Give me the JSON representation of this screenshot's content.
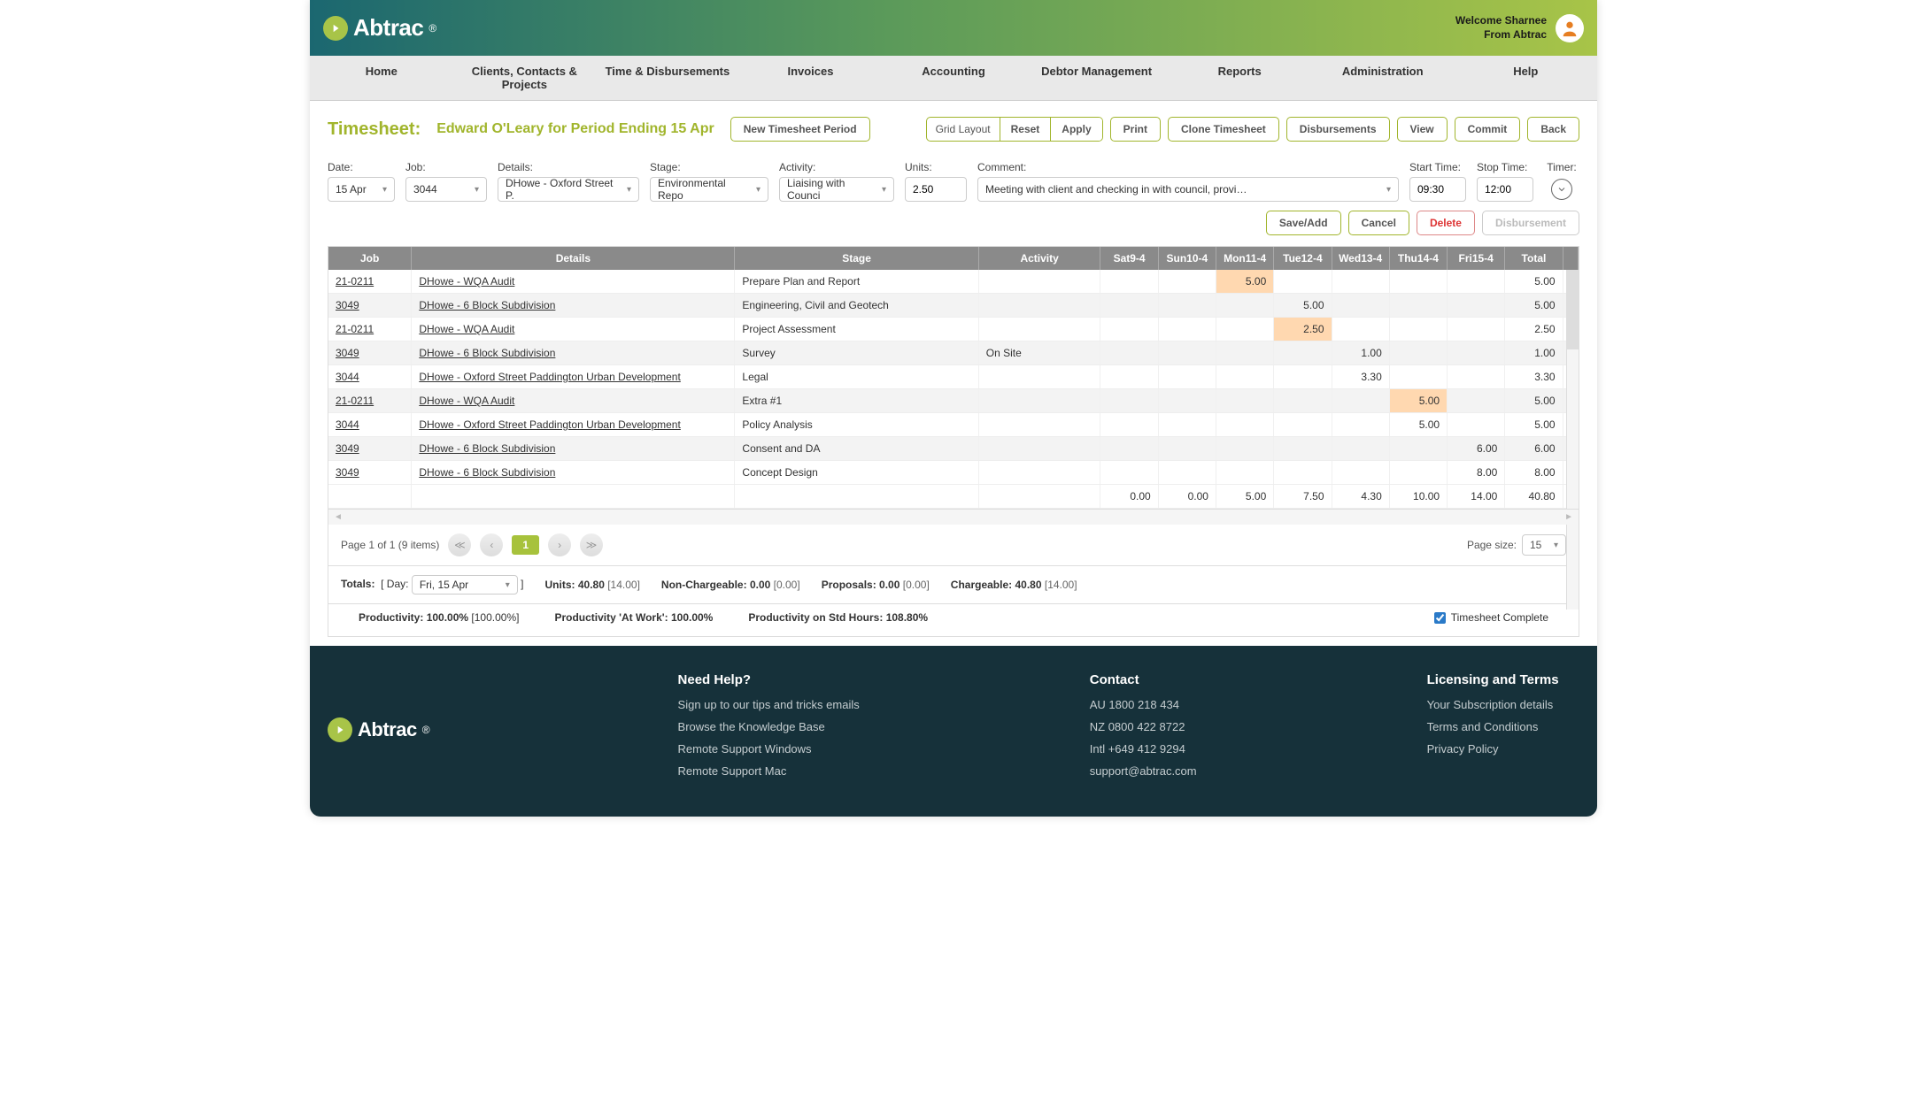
{
  "header": {
    "brand": "Abtrac",
    "welcome_line1": "Welcome Sharnee",
    "welcome_line2": "From Abtrac"
  },
  "nav": [
    "Home",
    "Clients, Contacts & Projects",
    "Time & Disbursements",
    "Invoices",
    "Accounting",
    "Debtor Management",
    "Reports",
    "Administration",
    "Help"
  ],
  "page": {
    "title": "Timesheet:",
    "subtitle": "Edward O'Leary for Period Ending 15 Apr",
    "new_period_btn": "New Timesheet Period",
    "grid_layout_label": "Grid Layout",
    "reset_btn": "Reset",
    "apply_btn": "Apply",
    "print_btn": "Print",
    "clone_btn": "Clone Timesheet",
    "disbursements_btn": "Disbursements",
    "view_btn": "View",
    "commit_btn": "Commit",
    "back_btn": "Back"
  },
  "form": {
    "date_label": "Date:",
    "date_value": "15 Apr",
    "job_label": "Job:",
    "job_value": "3044",
    "details_label": "Details:",
    "details_value": "DHowe - Oxford Street P.",
    "stage_label": "Stage:",
    "stage_value": "Environmental Repo",
    "activity_label": "Activity:",
    "activity_value": "Liaising with Counci",
    "units_label": "Units:",
    "units_value": "2.50",
    "comment_label": "Comment:",
    "comment_value": "Meeting with client and checking in with council, providing re",
    "start_label": "Start Time:",
    "start_value": "09:30",
    "stop_label": "Stop Time:",
    "stop_value": "12:00",
    "timer_label": "Timer:",
    "save_btn": "Save/Add",
    "cancel_btn": "Cancel",
    "delete_btn": "Delete",
    "disb_btn": "Disbursement"
  },
  "table": {
    "headers": {
      "job": "Job",
      "details": "Details",
      "stage": "Stage",
      "activity": "Activity",
      "days": [
        {
          "d": "Sat",
          "n": "9-4"
        },
        {
          "d": "Sun",
          "n": "10-4"
        },
        {
          "d": "Mon",
          "n": "11-4"
        },
        {
          "d": "Tue",
          "n": "12-4"
        },
        {
          "d": "Wed",
          "n": "13-4"
        },
        {
          "d": "Thu",
          "n": "14-4"
        },
        {
          "d": "Fri",
          "n": "15-4"
        }
      ],
      "total": "Total"
    },
    "rows": [
      {
        "job": "21-0211",
        "details": "DHowe - WQA Audit",
        "stage": "Prepare Plan and Report",
        "activity": "",
        "vals": [
          "",
          "",
          "5.00",
          "",
          "",
          "",
          ""
        ],
        "hl": [
          2
        ],
        "total": "5.00"
      },
      {
        "job": "3049",
        "details": "DHowe - 6 Block Subdivision",
        "stage": "Engineering, Civil and Geotech",
        "activity": "",
        "vals": [
          "",
          "",
          "",
          "5.00",
          "",
          "",
          ""
        ],
        "hl": [],
        "total": "5.00"
      },
      {
        "job": "21-0211",
        "details": "DHowe - WQA Audit",
        "stage": "Project Assessment",
        "activity": "",
        "vals": [
          "",
          "",
          "",
          "2.50",
          "",
          "",
          ""
        ],
        "hl": [
          3
        ],
        "total": "2.50"
      },
      {
        "job": "3049",
        "details": "DHowe - 6 Block Subdivision",
        "stage": "Survey",
        "activity": "On Site",
        "vals": [
          "",
          "",
          "",
          "",
          "1.00",
          "",
          ""
        ],
        "hl": [],
        "total": "1.00"
      },
      {
        "job": "3044",
        "details": "DHowe - Oxford Street Paddington Urban Development",
        "stage": "Legal",
        "activity": "",
        "vals": [
          "",
          "",
          "",
          "",
          "3.30",
          "",
          ""
        ],
        "hl": [],
        "total": "3.30"
      },
      {
        "job": "21-0211",
        "details": "DHowe - WQA Audit",
        "stage": "Extra #1",
        "activity": "",
        "vals": [
          "",
          "",
          "",
          "",
          "",
          "5.00",
          ""
        ],
        "hl": [
          5
        ],
        "total": "5.00"
      },
      {
        "job": "3044",
        "details": "DHowe - Oxford Street Paddington Urban Development",
        "stage": "Policy Analysis",
        "activity": "",
        "vals": [
          "",
          "",
          "",
          "",
          "",
          "5.00",
          ""
        ],
        "hl": [],
        "total": "5.00"
      },
      {
        "job": "3049",
        "details": "DHowe - 6 Block Subdivision",
        "stage": "Consent and DA",
        "activity": "",
        "vals": [
          "",
          "",
          "",
          "",
          "",
          "",
          "6.00"
        ],
        "hl": [],
        "total": "6.00"
      },
      {
        "job": "3049",
        "details": "DHowe - 6 Block Subdivision",
        "stage": "Concept Design",
        "activity": "",
        "vals": [
          "",
          "",
          "",
          "",
          "",
          "",
          "8.00"
        ],
        "hl": [],
        "total": "8.00"
      }
    ],
    "col_totals": [
      "0.00",
      "0.00",
      "5.00",
      "7.50",
      "4.30",
      "10.00",
      "14.00",
      "40.80"
    ]
  },
  "pager": {
    "summary": "Page 1 of 1 (9 items)",
    "current": "1",
    "page_size_label": "Page size:",
    "page_size_value": "15"
  },
  "totals": {
    "label": "Totals:",
    "day_label": "[ Day:",
    "day_value": "Fri, 15 Apr",
    "day_close": "]",
    "units_label": "Units:",
    "units_val": "40.80",
    "units_bracket": "[14.00]",
    "nonch_label": "Non-Chargeable:",
    "nonch_val": "0.00",
    "nonch_bracket": "[0.00]",
    "prop_label": "Proposals:",
    "prop_val": "0.00",
    "prop_bracket": "[0.00]",
    "charge_label": "Chargeable:",
    "charge_val": "40.80",
    "charge_bracket": "[14.00]",
    "prod_label": "Productivity:",
    "prod_val": "100.00%",
    "prod_bracket": "[100.00%]",
    "prodw_label": "Productivity 'At Work':",
    "prodw_val": "100.00%",
    "prods_label": "Productivity on Std Hours:",
    "prods_val": "108.80%",
    "complete_label": "Timesheet Complete"
  },
  "footer": {
    "help_h": "Need Help?",
    "help_links": [
      "Sign up to our tips and tricks emails",
      "Browse the Knowledge Base",
      "Remote Support Windows",
      "Remote Support Mac"
    ],
    "contact_h": "Contact",
    "contact_lines": [
      "AU 1800 218 434",
      "NZ 0800 422 8722",
      "Intl +649 412 9294",
      "support@abtrac.com"
    ],
    "lic_h": "Licensing and Terms",
    "lic_links": [
      "Your Subscription details",
      "Terms and Conditions",
      "Privacy Policy"
    ]
  }
}
